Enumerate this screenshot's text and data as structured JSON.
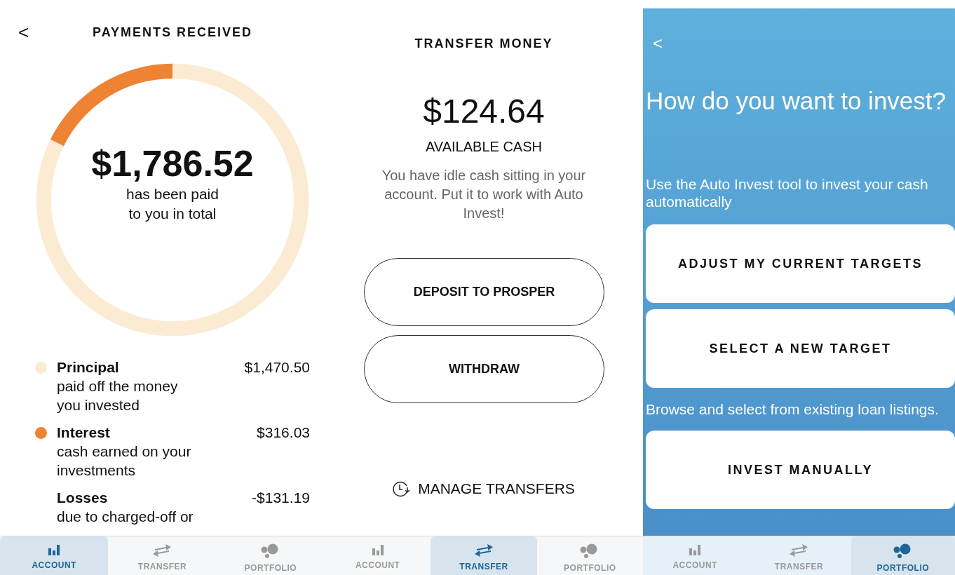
{
  "screens": [
    {
      "kind": "payments",
      "title": "PAYMENTS RECEIVED",
      "back": "<",
      "chart_data": {
        "type": "donut",
        "categories": [
          "Principal",
          "Interest"
        ],
        "values": [
          82.31,
          17.69
        ]
      },
      "total": "$1,786.52",
      "total_caption": "has been paid\nto you in total",
      "legend": [
        {
          "description": "paid off the money\nyou invested",
          "amount": "$1,470.50",
          "color": "#fbebd3"
        },
        {
          "description": "cash earned on your\ninvestments",
          "amount": "$316.03",
          "color": "#ee8433"
        },
        {
          "label": "Losses",
          "description": "due to charged-off or",
          "amount": "-$131.19"
        }
      ],
      "tabs": [
        {
          "kind": "account",
          "label": "ACCOUNT",
          "selected": true
        },
        {
          "kind": "transfer",
          "label": "TRANSFER",
          "selected": false
        },
        {
          "kind": "portfolio",
          "label": "PORTFOLIO",
          "selected": false
        }
      ]
    },
    {
      "kind": "transfer",
      "title": "TRANSFER MONEY",
      "amount": "$124.64",
      "amount_label": "AVAILABLE CASH",
      "message": "You have idle cash sitting in your account. Put it to work with Auto Invest!",
      "buttons": [
        "DEPOSIT TO PROSPER",
        "WITHDRAW"
      ],
      "link": "MANAGE TRANSFERS",
      "tabs": [
        {
          "kind": "account",
          "label": "ACCOUNT",
          "selected": false
        },
        {
          "kind": "transfer",
          "label": "TRANSFER",
          "selected": true
        },
        {
          "kind": "portfolio",
          "label": "PORTFOLIO",
          "selected": false
        }
      ]
    },
    {
      "kind": "invest",
      "back": "<",
      "heading": "How do you want to invest?",
      "sections": [
        {
          "text": "Use the Auto Invest tool to invest your cash automatically",
          "buttons": [
            "ADJUST MY CURRENT TARGETS",
            "SELECT A NEW TARGET"
          ]
        },
        {
          "text": "Browse and select from existing loan listings.",
          "buttons": [
            "INVEST MANUALLY"
          ]
        }
      ],
      "tabs": [
        {
          "kind": "account",
          "label": "ACCOUNT",
          "selected": false
        },
        {
          "kind": "transfer",
          "label": "TRANSFER",
          "selected": false
        },
        {
          "kind": "portfolio",
          "label": "PORTFOLIO",
          "selected": true
        }
      ]
    }
  ]
}
